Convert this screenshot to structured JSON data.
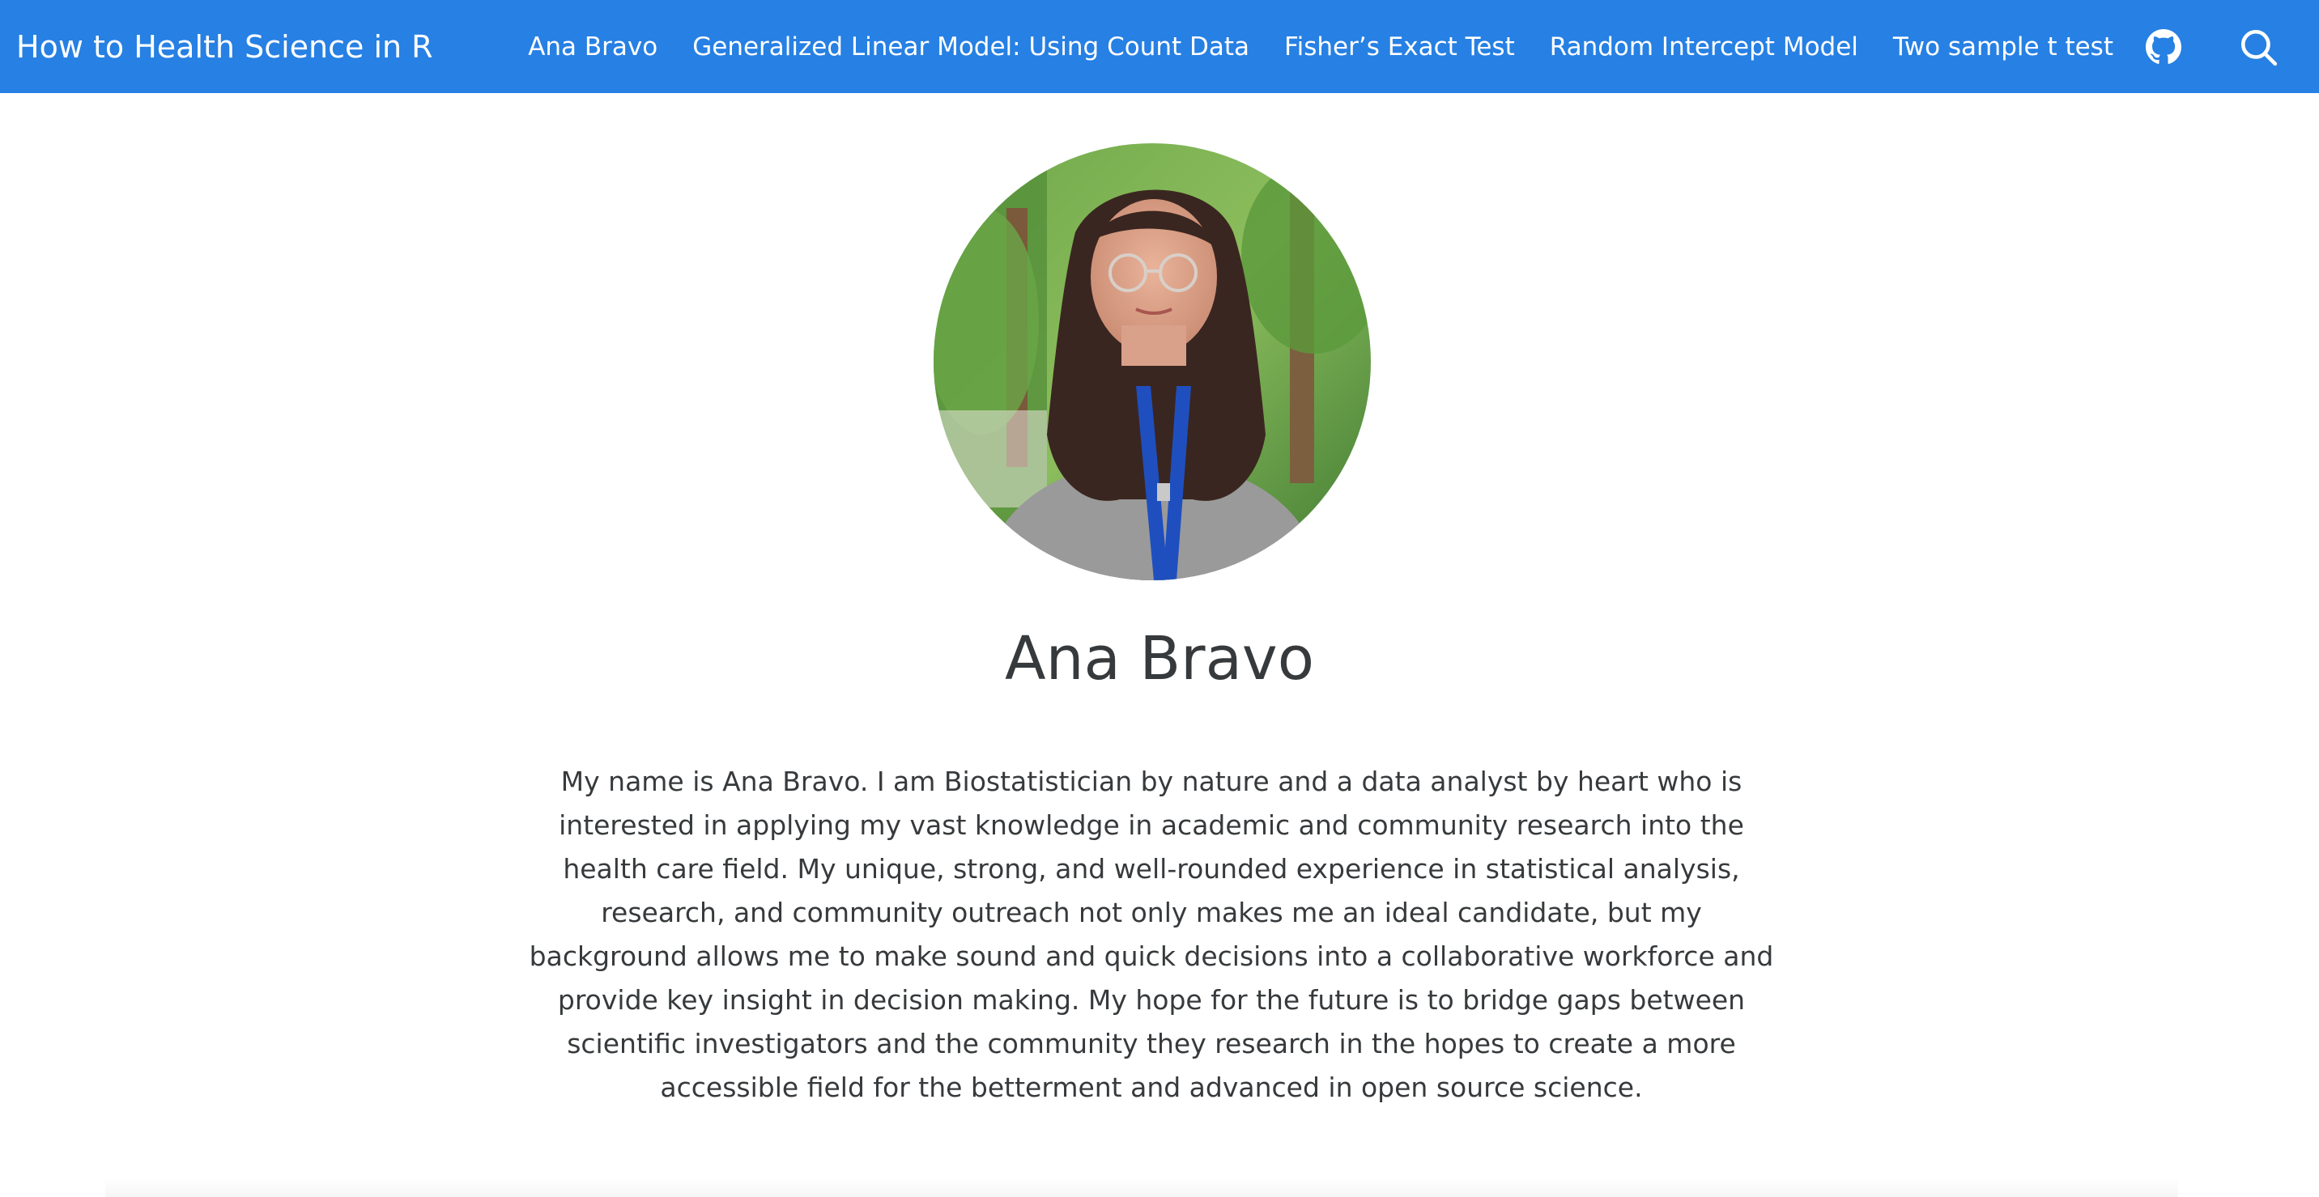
{
  "colors": {
    "navbar": "#2780e3",
    "nav_text": "#ffffff",
    "body_text": "#373a3c",
    "background": "#ffffff"
  },
  "navbar": {
    "brand": "How to Health Science in R",
    "links": [
      {
        "label": "Ana Bravo"
      },
      {
        "label": "Generalized Linear Model: Using Count Data"
      },
      {
        "label": "Fisher’s Exact Test"
      },
      {
        "label": "Random Intercept Model"
      },
      {
        "label": "Two sample t test"
      }
    ],
    "icons": [
      "github-icon",
      "search-icon"
    ]
  },
  "profile": {
    "photo_icon": "profile-photo",
    "name": "Ana Bravo",
    "bio": "My name is Ana Bravo. I am Biostatistician by nature and a data analyst by heart who is interested in applying my vast knowledge in academic and community research into the health care field. My unique, strong, and well-rounded experience in statistical analysis, research, and community outreach not only makes me an ideal candidate, but my background allows me to make sound and quick decisions into a collaborative workforce and provide key insight in decision making. My hope for the future is to bridge gaps between scientific investigators and the community they research in the hopes to create a more accessible field for the betterment and advanced in open source science."
  }
}
